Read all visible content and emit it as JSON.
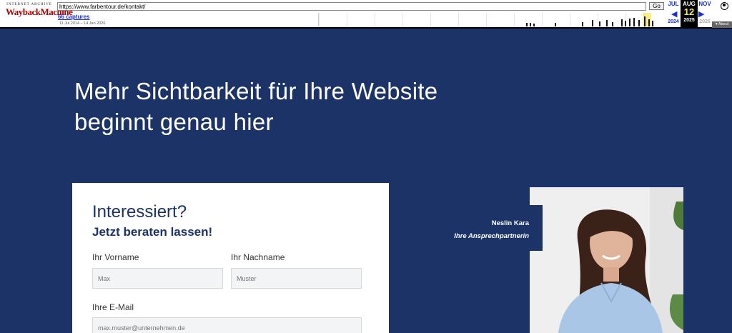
{
  "wayback": {
    "logo_small": "INTERNET ARCHIVE",
    "logo_big": "WaybackMachine",
    "url": "https://www.farbentour.de/kontakt/",
    "go_label": "Go",
    "captures_label": "66 captures",
    "date_range": "11 Jul 2014 – 14 Jan 2026",
    "calendar": {
      "prev": {
        "month": "JUL",
        "year": "2024"
      },
      "current": {
        "month": "AUG",
        "day": "12",
        "year": "2025"
      },
      "next": {
        "month": "NOV",
        "year": "2026"
      }
    },
    "about_label": "About",
    "icons": {
      "prev": "left-arrow-icon",
      "next": "right-arrow-icon",
      "user": "user-icon",
      "about": "caret-down-icon"
    }
  },
  "hero": {
    "line1": "Mehr Sichtbarkeit für Ihre Website",
    "line2": "beginnt genau hier"
  },
  "form": {
    "title": "Interessiert?",
    "subtitle": "Jetzt beraten lassen!",
    "first_name_label": "Ihr Vorname",
    "first_name_placeholder": "Max",
    "last_name_label": "Ihr Nachname",
    "last_name_placeholder": "Muster",
    "email_label": "Ihre E-Mail",
    "email_placeholder": "max.muster@unternehmen.de"
  },
  "contact": {
    "name": "Neslin Kara",
    "role": "Ihre Ansprechpartnerin"
  },
  "colors": {
    "page_bg": "#1b3366",
    "accent_text": "#1b3366",
    "field_bg": "#f3f4f6"
  }
}
